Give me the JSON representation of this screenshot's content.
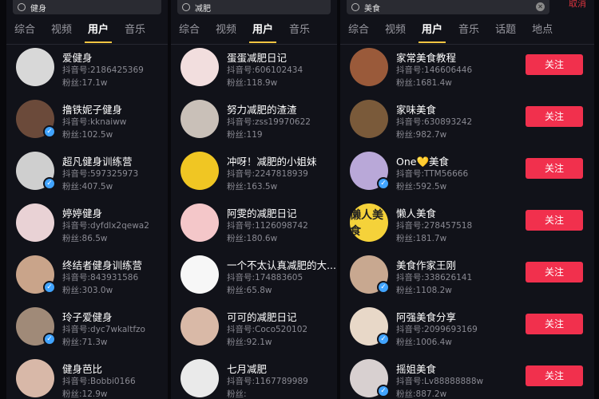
{
  "panels": [
    {
      "search_text": "健身",
      "tabs": [
        "综合",
        "视频",
        "用户",
        "音乐"
      ],
      "active_tab": "用户",
      "users": [
        {
          "name": "爱健身",
          "id": "抖音号:2186425369",
          "fans": "粉丝:17.1w",
          "color": "#d8d8d8",
          "verified": false
        },
        {
          "name": "撸铁妮子健身",
          "id": "抖音号:kknaiww",
          "fans": "粉丝:102.5w",
          "color": "#6b4a3a",
          "verified": true
        },
        {
          "name": "超凡健身训练营",
          "id": "抖音号:597325973",
          "fans": "粉丝:407.5w",
          "color": "#cfcfcf",
          "verified": true
        },
        {
          "name": "婷婷健身",
          "id": "抖音号:dyfdlx2qewa2",
          "fans": "粉丝:86.5w",
          "color": "#e9d2d5",
          "verified": false
        },
        {
          "name": "终结者健身训练营",
          "id": "抖音号:843931586",
          "fans": "粉丝:303.0w",
          "color": "#c9a48a",
          "verified": true
        },
        {
          "name": "玲子爱健身",
          "id": "抖音号:dyc7wkaltfzo",
          "fans": "粉丝:71.3w",
          "color": "#a08a78",
          "verified": true
        },
        {
          "name": "健身芭比",
          "id": "抖音号:Bobbi0166",
          "fans": "粉丝:12.9w",
          "color": "#d8b8a8",
          "verified": false
        }
      ]
    },
    {
      "search_text": "减肥",
      "tabs": [
        "综合",
        "视频",
        "用户",
        "音乐"
      ],
      "active_tab": "用户",
      "users": [
        {
          "name": "蛋蛋减肥日记",
          "id": "抖音号:606102434",
          "fans": "粉丝:118.9w",
          "color": "#f2dede",
          "verified": false
        },
        {
          "name": "努力减肥的渣渣",
          "id": "抖音号:zss19970622",
          "fans": "粉丝:119",
          "color": "#c9c0b8",
          "verified": false
        },
        {
          "name": "冲呀！减肥的小姐妹",
          "id": "抖音号:2247818939",
          "fans": "粉丝:163.5w",
          "color": "#f0c623",
          "verified": false
        },
        {
          "name": "阿雯的减肥日记",
          "id": "抖音号:1126098742",
          "fans": "粉丝:180.6w",
          "color": "#f4c7c9",
          "verified": false
        },
        {
          "name": "一个不太认真减肥的大...",
          "id": "抖音号:174883605",
          "fans": "粉丝:65.8w",
          "color": "#f7f7f7",
          "verified": false
        },
        {
          "name": "可可的减肥日记",
          "id": "抖音号:Coco520102",
          "fans": "粉丝:92.1w",
          "color": "#d9b9a7",
          "verified": false
        },
        {
          "name": "七月减肥",
          "id": "抖音号:1167789989",
          "fans": "粉丝:",
          "color": "#eaeaea",
          "verified": false
        }
      ]
    },
    {
      "search_text": "美食",
      "tabs": [
        "综合",
        "视频",
        "用户",
        "音乐",
        "话题",
        "地点"
      ],
      "active_tab": "用户",
      "cancel_label": "取消",
      "follow_label": "关注",
      "users": [
        {
          "name": "家常美食教程",
          "id": "抖音号:146606446",
          "fans": "粉丝:1681.4w",
          "color": "#9a5a3a",
          "verified": false
        },
        {
          "name": "家味美食",
          "id": "抖音号:630893242",
          "fans": "粉丝:982.7w",
          "color": "#7a5a3a",
          "verified": false
        },
        {
          "name": "One💛美食",
          "id": "抖音号:TTM56666",
          "fans": "粉丝:592.5w",
          "color": "#b9a8d8",
          "verified": true
        },
        {
          "name": "懒人美食",
          "id": "抖音号:278457518",
          "fans": "粉丝:181.7w",
          "color": "#f5d23a",
          "verified": false,
          "glyph": "懒人美食"
        },
        {
          "name": "美食作家王刚",
          "id": "抖音号:338626141",
          "fans": "粉丝:1108.2w",
          "color": "#c8a890",
          "verified": true
        },
        {
          "name": "阿强美食分享",
          "id": "抖音号:2099693169",
          "fans": "粉丝:1006.4w",
          "color": "#e8d8c8",
          "verified": true
        },
        {
          "name": "摇姐美食",
          "id": "抖音号:Lv88888888w",
          "fans": "粉丝:887.2w",
          "color": "#d8d0d0",
          "verified": true
        }
      ]
    }
  ]
}
